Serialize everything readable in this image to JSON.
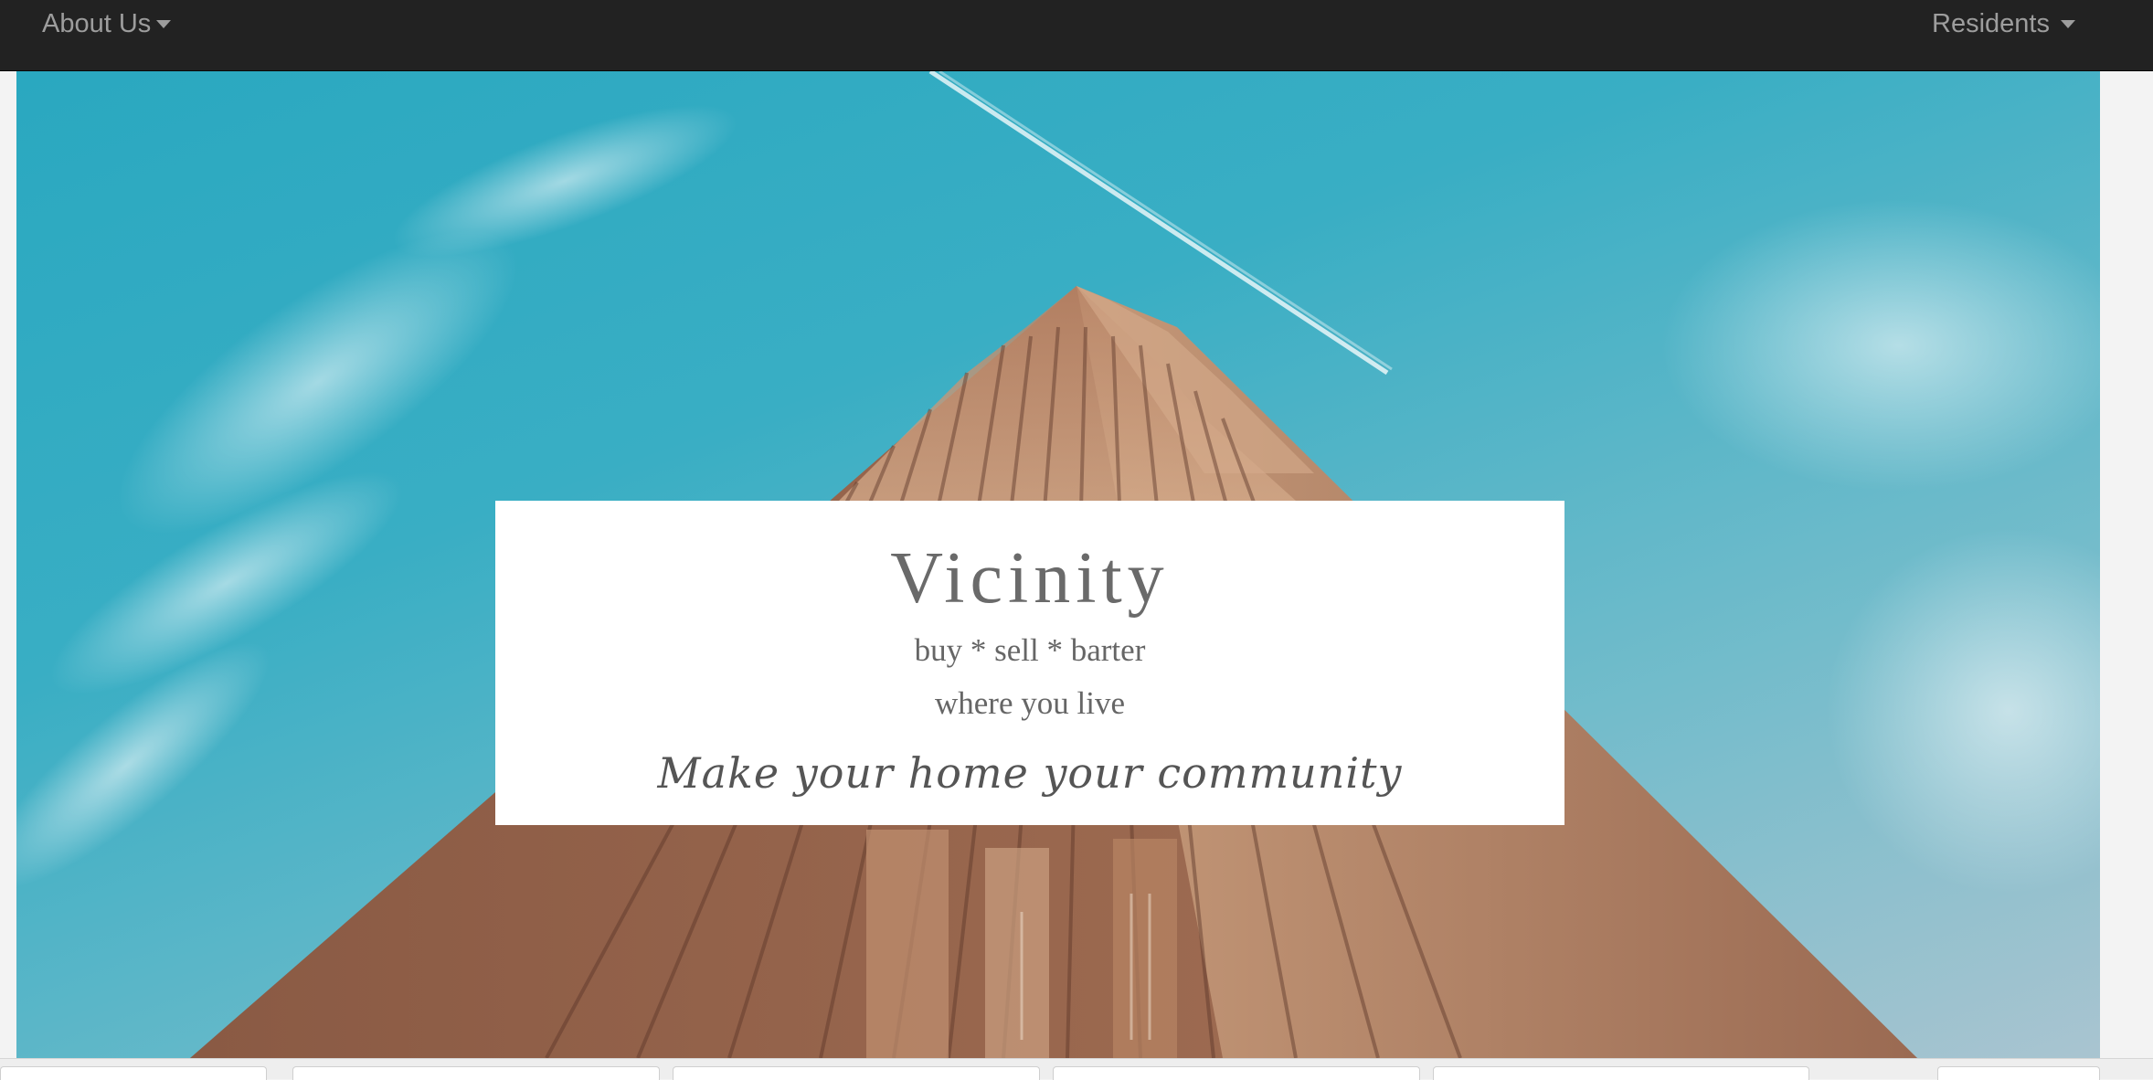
{
  "navbar": {
    "left_item": "About Us",
    "right_item": "Residents",
    "background": "#222222",
    "text_color": "#9d9d9d"
  },
  "hero": {
    "image": "skyscraper-looking-up-blue-sky",
    "card": {
      "title": "Vicinity",
      "subtitle_line1": "buy * sell * barter",
      "subtitle_line2": "where you live",
      "tagline": "Make your home your community"
    }
  },
  "icons": {
    "dropdown": "caret-down-icon"
  },
  "colors": {
    "sky": "#2aa8c0",
    "building": "#9a6a52",
    "card_text": "#666666"
  }
}
